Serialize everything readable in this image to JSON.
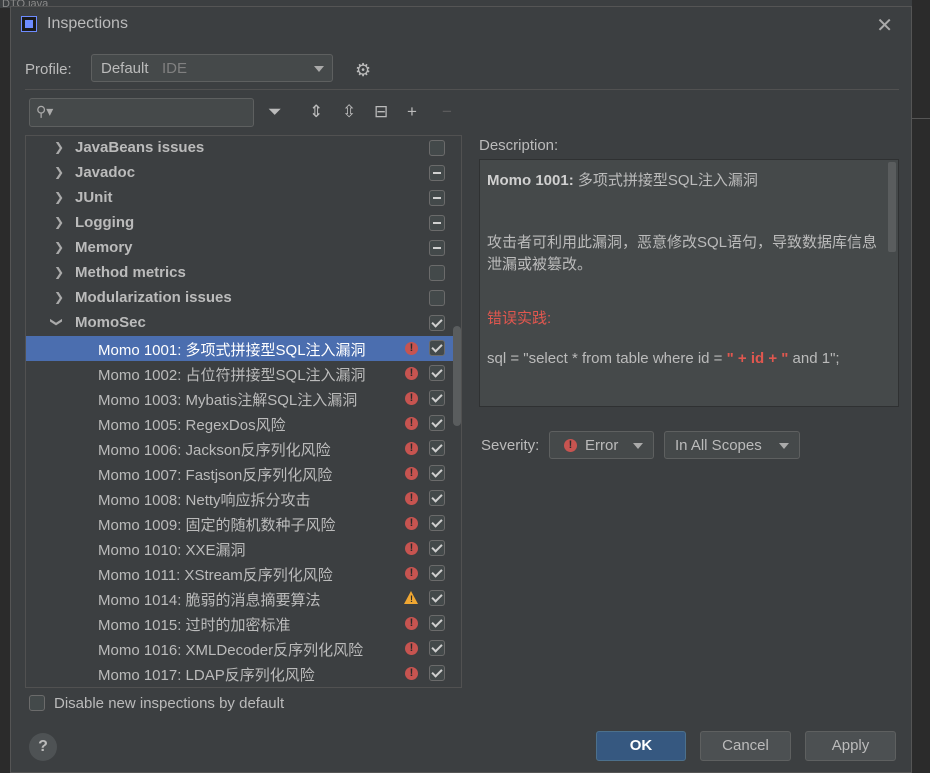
{
  "editor_tab": "DTO.java",
  "dialog": {
    "title": "Inspections",
    "close_icon": "close-icon"
  },
  "profile": {
    "label": "Profile:",
    "value": "Default",
    "scope": "IDE"
  },
  "groups": [
    {
      "label": "JavaBeans issues",
      "state": "unchecked"
    },
    {
      "label": "Javadoc",
      "state": "partial"
    },
    {
      "label": "JUnit",
      "state": "partial"
    },
    {
      "label": "Logging",
      "state": "partial"
    },
    {
      "label": "Memory",
      "state": "partial"
    },
    {
      "label": "Method metrics",
      "state": "unchecked"
    },
    {
      "label": "Modularization issues",
      "state": "unchecked"
    },
    {
      "label": "MomoSec",
      "state": "checked",
      "expanded": true
    }
  ],
  "items": [
    {
      "label": "Momo 1001: 多项式拼接型SQL注入漏洞",
      "severity": "error"
    },
    {
      "label": "Momo 1002: 占位符拼接型SQL注入漏洞",
      "severity": "error"
    },
    {
      "label": "Momo 1003: Mybatis注解SQL注入漏洞",
      "severity": "error"
    },
    {
      "label": "Momo 1005: RegexDos风险",
      "severity": "error"
    },
    {
      "label": "Momo 1006: Jackson反序列化风险",
      "severity": "error"
    },
    {
      "label": "Momo 1007: Fastjson反序列化风险",
      "severity": "error"
    },
    {
      "label": "Momo 1008: Netty响应拆分攻击",
      "severity": "error"
    },
    {
      "label": "Momo 1009: 固定的随机数种子风险",
      "severity": "error"
    },
    {
      "label": "Momo 1010: XXE漏洞",
      "severity": "error"
    },
    {
      "label": "Momo 1011: XStream反序列化风险",
      "severity": "error"
    },
    {
      "label": "Momo 1014: 脆弱的消息摘要算法",
      "severity": "warning"
    },
    {
      "label": "Momo 1015: 过时的加密标准",
      "severity": "error"
    },
    {
      "label": "Momo 1016: XMLDecoder反序列化风险",
      "severity": "error"
    },
    {
      "label": "Momo 1017: LDAP反序列化风险",
      "severity": "error"
    }
  ],
  "description": {
    "label": "Description:",
    "title_bold": "Momo 1001:",
    "title_rest": " 多项式拼接型SQL注入漏洞",
    "para1": "攻击者可利用此漏洞，恶意修改SQL语句，导致数据库信息泄漏或被篡改。",
    "bad_practice": "错误实践:",
    "code_a": "sql = \"select * from table where id = ",
    "code_b": "\" + id + \"",
    "code_c": " and 1\";"
  },
  "severity": {
    "label": "Severity:",
    "value": "Error",
    "scope": "In All Scopes"
  },
  "bottom": {
    "disable_label": "Disable new inspections by default",
    "help": "?"
  },
  "buttons": {
    "ok": "OK",
    "cancel": "Cancel",
    "apply": "Apply"
  },
  "colors": {
    "selection": "#4b6eaf",
    "error": "#c75450",
    "warning": "#f0a732",
    "primary_button": "#365880"
  }
}
